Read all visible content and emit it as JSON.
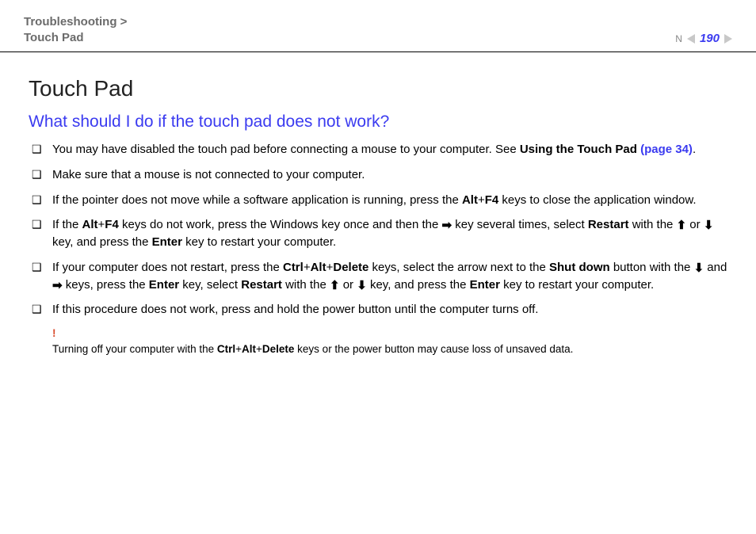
{
  "header": {
    "breadcrumb_line1": "Troubleshooting >",
    "breadcrumb_line2": "Touch Pad",
    "page_number": "190",
    "n_label": "N"
  },
  "title": "Touch Pad",
  "subtitle": "What should I do if the touch pad does not work?",
  "items": [
    {
      "pre": "You may have disabled the touch pad before connecting a mouse to your computer. See ",
      "bold1": "Using the Touch Pad ",
      "link": "(page 34)",
      "post": "."
    },
    {
      "text": "Make sure that a mouse is not connected to your computer."
    },
    {
      "pre": "If the pointer does not move while a software application is running, press the ",
      "k1": "Alt",
      "plus1": "+",
      "k2": "F4",
      "post": " keys to close the application window."
    },
    {
      "pre": "If the ",
      "k1": "Alt",
      "plus1": "+",
      "k2": "F4",
      "mid1": " keys do not work, press the Windows key once and then the ",
      "arrowA": "➡",
      "mid2": " key several times, select ",
      "k3": "Restart",
      "mid3": " with the ",
      "arrowB": "⬆",
      "mid4": " or ",
      "arrowC": "⬇",
      "mid5": " key, and press the ",
      "k4": "Enter",
      "post": " key to restart your computer."
    },
    {
      "pre": "If your computer does not restart, press the ",
      "k1": "Ctrl",
      "plus1": "+",
      "k2": "Alt",
      "plus2": "+",
      "k3": "Delete",
      "mid1": " keys, select the arrow next to the ",
      "k4": "Shut down",
      "mid2": " button with the ",
      "arrowA": "⬇",
      "mid3": " and ",
      "arrowB": "➡",
      "mid4": " keys, press the ",
      "k5": "Enter",
      "mid5": " key, select ",
      "k6": "Restart",
      "mid6": " with the ",
      "arrowC": "⬆",
      "mid7": " or ",
      "arrowD": "⬇",
      "mid8": " key, and press the ",
      "k7": "Enter",
      "post": " key to restart your computer."
    },
    {
      "text": "If this procedure does not work, press and hold the power button until the computer turns off."
    }
  ],
  "warning": {
    "bang": "!",
    "pre": "Turning off your computer with the ",
    "k1": "Ctrl",
    "plus1": "+",
    "k2": "Alt",
    "plus2": "+",
    "k3": "Delete",
    "post": " keys or the power button may cause loss of unsaved data."
  }
}
